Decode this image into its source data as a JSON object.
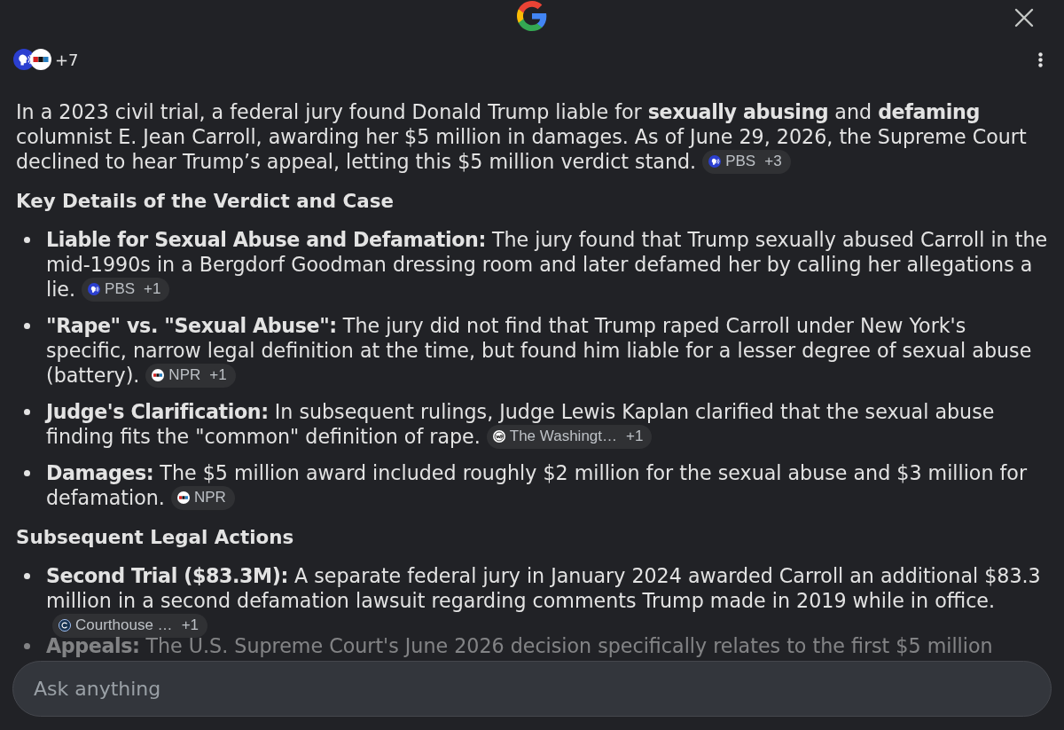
{
  "sources": {
    "logos": [
      {
        "kind": "pbs"
      },
      {
        "kind": "npr"
      }
    ],
    "more": "+7"
  },
  "answer": {
    "intro": {
      "text": "In a 2023 civil trial, a federal jury found Donald Trump liable for **sexually abusing** and **defaming** columnist E. Jean Carroll, awarding her $5 million in damages. As of June 29, 2026, the Supreme Court declined to hear Trump’s appeal, letting this $5 million verdict stand.",
      "citation": {
        "kind": "pbs",
        "source": "PBS",
        "extra": "+3"
      }
    },
    "sections": [
      {
        "heading": "Key Details of the Verdict and Case",
        "items": [
          {
            "text": "**Liable for Sexual Abuse and Defamation:** The jury found that Trump sexually abused Carroll in the mid-1990s in a Bergdorf Goodman dressing room and later defamed her by calling her allegations a lie.",
            "faded": false,
            "citation": {
              "kind": "pbs",
              "source": "PBS",
              "extra": "+1"
            }
          },
          {
            "text": "**\"Rape\" vs. \"Sexual Abuse\":** The jury did not find that Trump raped Carroll under New York's specific, narrow legal definition at the time, but found him liable for a lesser degree of sexual abuse (battery).",
            "faded": false,
            "citation": {
              "kind": "npr",
              "source": "NPR",
              "extra": "+1"
            }
          },
          {
            "text": "**Judge's Clarification:** In subsequent rulings, Judge Lewis Kaplan clarified that the sexual abuse finding fits the \"common\" definition of rape.",
            "faded": false,
            "citation": {
              "kind": "wp",
              "source": "The Washingt…",
              "extra": "+1"
            }
          },
          {
            "text": "**Damages:** The $5 million award included roughly $2 million for the sexual abuse and $3 million for defamation.",
            "faded": false,
            "citation": {
              "kind": "npr",
              "source": "NPR"
            }
          }
        ]
      },
      {
        "heading": "Subsequent Legal Actions",
        "items": [
          {
            "text": "**Second Trial ($83.3M):** A separate federal jury in January 2024 awarded Carroll an additional $83.3 million in a second defamation lawsuit regarding comments Trump made in 2019 while in office.",
            "faded": false,
            "citation": {
              "kind": "letter",
              "source": "Courthouse …",
              "extra": "+1"
            }
          },
          {
            "text": "**Appeals:** The U.S. Supreme Court's June 2026 decision specifically relates to the first $5 million",
            "faded": true
          }
        ]
      }
    ]
  },
  "composer": {
    "placeholder": "Ask anything"
  }
}
